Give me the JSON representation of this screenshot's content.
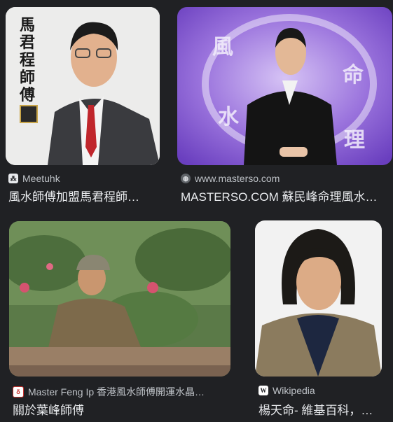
{
  "results": [
    {
      "source": "Meetuhk",
      "favicon": "meetuhk-favicon",
      "title": "風水師傅加盟馬君程師…",
      "image_text": [
        "馬",
        "君",
        "程",
        "師",
        "傅"
      ]
    },
    {
      "source": "www.masterso.com",
      "favicon": "globe-favicon",
      "title": "MASTERSO.COM 蘇民峰命理風水…",
      "image_text": [
        "風",
        "水",
        "命",
        "理"
      ]
    },
    {
      "source": "Master Feng Ip 香港風水師傅開運水晶…",
      "favicon": "fengip-favicon",
      "title": "關於葉峰師傅"
    },
    {
      "source": "Wikipedia",
      "favicon": "wikipedia-favicon",
      "title": "楊天命- 維基百科，…"
    }
  ],
  "colors": {
    "background": "#202124",
    "source_text": "#bdc1c6",
    "title_text": "#e8eaed"
  }
}
